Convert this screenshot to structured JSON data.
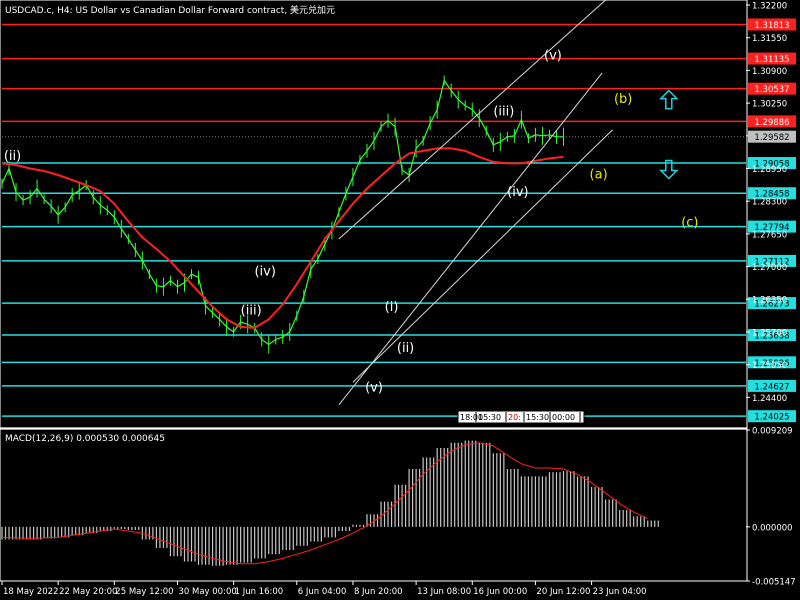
{
  "chart_title": "USDCAD.c, H4:  US Dollar vs Canadian Dollar Forward contract, 美元兑加元",
  "colors": {
    "background": "#000000",
    "price": "#33ff33",
    "ma": "#ff2020",
    "level_red": "#ff2020",
    "level_cyan": "#22e0e0",
    "channel": "#d8d8d8",
    "wave_white": "#ffffff",
    "wave_yellow": "#e5e510",
    "arrow": "#22d0e0",
    "hist": "#c8c8c8",
    "macd_signal": "#ff2020",
    "axis": "#ffffff"
  },
  "chart_data": [
    {
      "type": "line",
      "title": "USDCAD.c, H4:  US Dollar vs Canadian Dollar Forward contract, 美元兑加元",
      "ylim": [
        1.2381,
        1.3226
      ],
      "y_ticks": [
        "1.32200",
        "1.31550",
        "1.30900",
        "1.30250",
        "1.29600",
        "1.28950",
        "1.28300",
        "1.27650",
        "1.27000",
        "1.26350",
        "1.25700",
        "1.25050",
        "1.24400"
      ],
      "y_tick_values": [
        1.322,
        1.3155,
        1.309,
        1.3025,
        1.296,
        1.2895,
        1.283,
        1.2765,
        1.27,
        1.2635,
        1.257,
        1.2505,
        1.244
      ],
      "x_ticks": [
        "18 May 2022",
        "22 May 20:00",
        "25 May 12:00",
        "30 May 00:00",
        "1 Jun 16:00",
        "6 Jun 04:00",
        "8 Jun 20:00",
        "13 Jun 08:00",
        "16 Jun 00:00",
        "20 Jun 12:00",
        "23 Jun 04:00"
      ],
      "x_tick_index": [
        0,
        16,
        32,
        50,
        66,
        84,
        100,
        118,
        134,
        152,
        168
      ],
      "current_price": {
        "value": 1.29582,
        "label": "1.29582"
      },
      "horizontal_levels": [
        {
          "value": 1.31813,
          "label": "1.31813",
          "color": "red"
        },
        {
          "value": 1.31135,
          "label": "1.31135",
          "color": "red"
        },
        {
          "value": 1.30537,
          "label": "1.30537",
          "color": "red"
        },
        {
          "value": 1.29886,
          "label": "1.29886",
          "color": "red"
        },
        {
          "value": 1.29058,
          "label": "1.29058",
          "color": "cyan"
        },
        {
          "value": 1.28458,
          "label": "1.28458",
          "color": "cyan"
        },
        {
          "value": 1.27794,
          "label": "1.27794",
          "color": "cyan"
        },
        {
          "value": 1.27112,
          "label": "1.27112",
          "color": "cyan"
        },
        {
          "value": 1.26273,
          "label": "1.26273",
          "color": "cyan"
        },
        {
          "value": 1.25638,
          "label": "1.25638",
          "color": "cyan"
        },
        {
          "value": 1.25096,
          "label": "1.25096",
          "color": "cyan"
        },
        {
          "value": 1.24627,
          "label": "1.24627",
          "color": "cyan"
        },
        {
          "value": 1.24025,
          "label": "1.24025",
          "color": "cyan"
        }
      ],
      "series": [
        {
          "kind": "price",
          "x": [
            0,
            2,
            4,
            6,
            8,
            10,
            12,
            14,
            16,
            18,
            20,
            22,
            24,
            26,
            28,
            30,
            32,
            34,
            36,
            38,
            40,
            42,
            44,
            46,
            48,
            50,
            52,
            54,
            56,
            58,
            60,
            62,
            64,
            66,
            68,
            70,
            72,
            74,
            76,
            78,
            80,
            82,
            84,
            86,
            88,
            90,
            92,
            94,
            96,
            98,
            100,
            102,
            104,
            106,
            108,
            110,
            112,
            114,
            116,
            118,
            120,
            122,
            124,
            126,
            128,
            130,
            132,
            134,
            136,
            138,
            140,
            142,
            144,
            146,
            148,
            150,
            152,
            154,
            156,
            158,
            160
          ],
          "y": [
            1.2865,
            1.2895,
            1.2848,
            1.2832,
            1.2838,
            1.2855,
            1.2834,
            1.282,
            1.2803,
            1.2818,
            1.2842,
            1.2851,
            1.2862,
            1.2838,
            1.2822,
            1.2812,
            1.2798,
            1.2775,
            1.2755,
            1.2733,
            1.2712,
            1.2685,
            1.2662,
            1.266,
            1.2672,
            1.266,
            1.2668,
            1.2685,
            1.2678,
            1.2622,
            1.2608,
            1.2595,
            1.258,
            1.257,
            1.259,
            1.2585,
            1.2578,
            1.2555,
            1.2545,
            1.2555,
            1.256,
            1.257,
            1.2602,
            1.264,
            1.2695,
            1.2715,
            1.2745,
            1.2772,
            1.2808,
            1.2845,
            1.2878,
            1.2912,
            1.293,
            1.295,
            1.2978,
            1.299,
            1.2978,
            1.2892,
            1.2882,
            1.2935,
            1.295,
            1.2985,
            1.3012,
            1.307,
            1.305,
            1.3032,
            1.302,
            1.3012,
            1.2995,
            1.297,
            1.2942,
            1.2948,
            1.2958,
            1.296,
            1.2992,
            1.2955,
            1.2962,
            1.296,
            1.2962,
            1.2958,
            1.2958
          ]
        },
        {
          "kind": "moving_average",
          "x": [
            0,
            4,
            8,
            12,
            16,
            20,
            24,
            28,
            32,
            36,
            40,
            44,
            48,
            52,
            56,
            60,
            64,
            68,
            72,
            76,
            80,
            84,
            88,
            92,
            96,
            100,
            104,
            108,
            112,
            116,
            120,
            124,
            128,
            132,
            136,
            140,
            144,
            148,
            152,
            156,
            160
          ],
          "y": [
            1.2905,
            1.2902,
            1.2895,
            1.289,
            1.2882,
            1.2872,
            1.2862,
            1.285,
            1.2825,
            1.279,
            1.2758,
            1.2735,
            1.271,
            1.268,
            1.265,
            1.262,
            1.2595,
            1.258,
            1.2578,
            1.2595,
            1.2625,
            1.2665,
            1.271,
            1.2755,
            1.279,
            1.2825,
            1.2855,
            1.288,
            1.2905,
            1.2925,
            1.293,
            1.2935,
            1.2935,
            1.293,
            1.2918,
            1.2908,
            1.2905,
            1.2905,
            1.291,
            1.2915,
            1.2918
          ]
        }
      ],
      "wave_labels": [
        {
          "text": "(ii)",
          "x": 3,
          "y": 1.2912,
          "color": "white"
        },
        {
          "text": "(iv)",
          "x": 75,
          "y": 1.2682,
          "color": "white"
        },
        {
          "text": "(iii)",
          "x": 71,
          "y": 1.2605,
          "color": "white"
        },
        {
          "text": "(i)",
          "x": 111,
          "y": 1.2612,
          "color": "white"
        },
        {
          "text": "(ii)",
          "x": 115,
          "y": 1.253,
          "color": "white"
        },
        {
          "text": "(v)",
          "x": 106,
          "y": 1.2452,
          "color": "white"
        },
        {
          "text": "(iii)",
          "x": 143,
          "y": 1.3,
          "color": "white"
        },
        {
          "text": "(iv)",
          "x": 147,
          "y": 1.284,
          "color": "white"
        },
        {
          "text": "(v)",
          "x": 157,
          "y": 1.3112,
          "color": "white"
        },
        {
          "text": "(b)",
          "x": 177,
          "y": 1.3025,
          "color": "yellow"
        },
        {
          "text": "(a)",
          "x": 170,
          "y": 1.2875,
          "color": "yellow"
        },
        {
          "text": "(c)",
          "x": 196,
          "y": 1.278,
          "color": "yellow"
        }
      ],
      "channel_lines": [
        {
          "x1": 96,
          "y1": 1.2425,
          "x2": 171,
          "y2": 1.3085
        },
        {
          "x1": 96,
          "y1": 1.2755,
          "x2": 172,
          "y2": 1.323
        },
        {
          "x1": 100,
          "y1": 1.247,
          "x2": 174,
          "y2": 1.2972
        }
      ],
      "arrows": [
        {
          "direction": "up",
          "x": 190,
          "y": 1.303
        },
        {
          "direction": "down",
          "x": 190,
          "y": 1.2895
        }
      ],
      "scroll_labels": [
        "18:00",
        "15:30",
        "20:",
        "15:30",
        "00:00"
      ],
      "x_range": [
        0,
        212
      ]
    },
    {
      "type": "bar",
      "title": "MACD(12,26,9) 0.000530 0.000645",
      "ylim": [
        -0.005147,
        0.009209
      ],
      "y_ticks": [
        "0.009209",
        "0.000000",
        "-0.005147"
      ],
      "y_tick_values": [
        0.009209,
        0.0,
        -0.005147
      ],
      "series": [
        {
          "name": "MACD",
          "kind": "histogram",
          "x": [
            0,
            4,
            8,
            12,
            16,
            20,
            24,
            28,
            32,
            36,
            40,
            44,
            48,
            52,
            56,
            60,
            64,
            68,
            72,
            76,
            80,
            84,
            88,
            92,
            96,
            100,
            104,
            108,
            112,
            116,
            120,
            124,
            128,
            132,
            136,
            140,
            144,
            148,
            152,
            156,
            160,
            164,
            168,
            172,
            176,
            180,
            184
          ],
          "y": [
            -0.0012,
            -0.0012,
            -0.0012,
            -0.0011,
            -0.001,
            -0.0008,
            -0.0006,
            -0.0004,
            -0.0002,
            -0.0003,
            -0.0012,
            -0.002,
            -0.0028,
            -0.0033,
            -0.0036,
            -0.0037,
            -0.0036,
            -0.0034,
            -0.003,
            -0.0026,
            -0.0022,
            -0.0018,
            -0.0014,
            -0.001,
            -0.0004,
            0.0002,
            0.0012,
            0.0024,
            0.004,
            0.0055,
            0.0066,
            0.0075,
            0.008,
            0.0082,
            0.008,
            0.007,
            0.0055,
            0.0048,
            0.0048,
            0.0052,
            0.0053,
            0.0048,
            0.0038,
            0.0026,
            0.0016,
            0.001,
            0.0006
          ]
        },
        {
          "name": "Signal",
          "kind": "line",
          "x": [
            0,
            8,
            16,
            24,
            32,
            40,
            44,
            48,
            52,
            56,
            60,
            64,
            68,
            72,
            76,
            80,
            84,
            88,
            92,
            96,
            100,
            104,
            108,
            112,
            116,
            120,
            124,
            128,
            132,
            136,
            140,
            144,
            148,
            152,
            156,
            160,
            164,
            168,
            172,
            176,
            180,
            184
          ],
          "y": [
            -0.001,
            -0.0011,
            -0.001,
            -0.0006,
            -0.0002,
            -0.0006,
            -0.0011,
            -0.0016,
            -0.0021,
            -0.0026,
            -0.003,
            -0.0033,
            -0.0035,
            -0.0035,
            -0.0033,
            -0.003,
            -0.0026,
            -0.0022,
            -0.0017,
            -0.0012,
            -0.0006,
            0.0001,
            0.001,
            0.0022,
            0.0035,
            0.005,
            0.0062,
            0.0072,
            0.0078,
            0.008,
            0.0077,
            0.0068,
            0.006,
            0.0056,
            0.0056,
            0.0055,
            0.005,
            0.0042,
            0.0032,
            0.0022,
            0.0014,
            0.0008
          ]
        }
      ]
    }
  ]
}
